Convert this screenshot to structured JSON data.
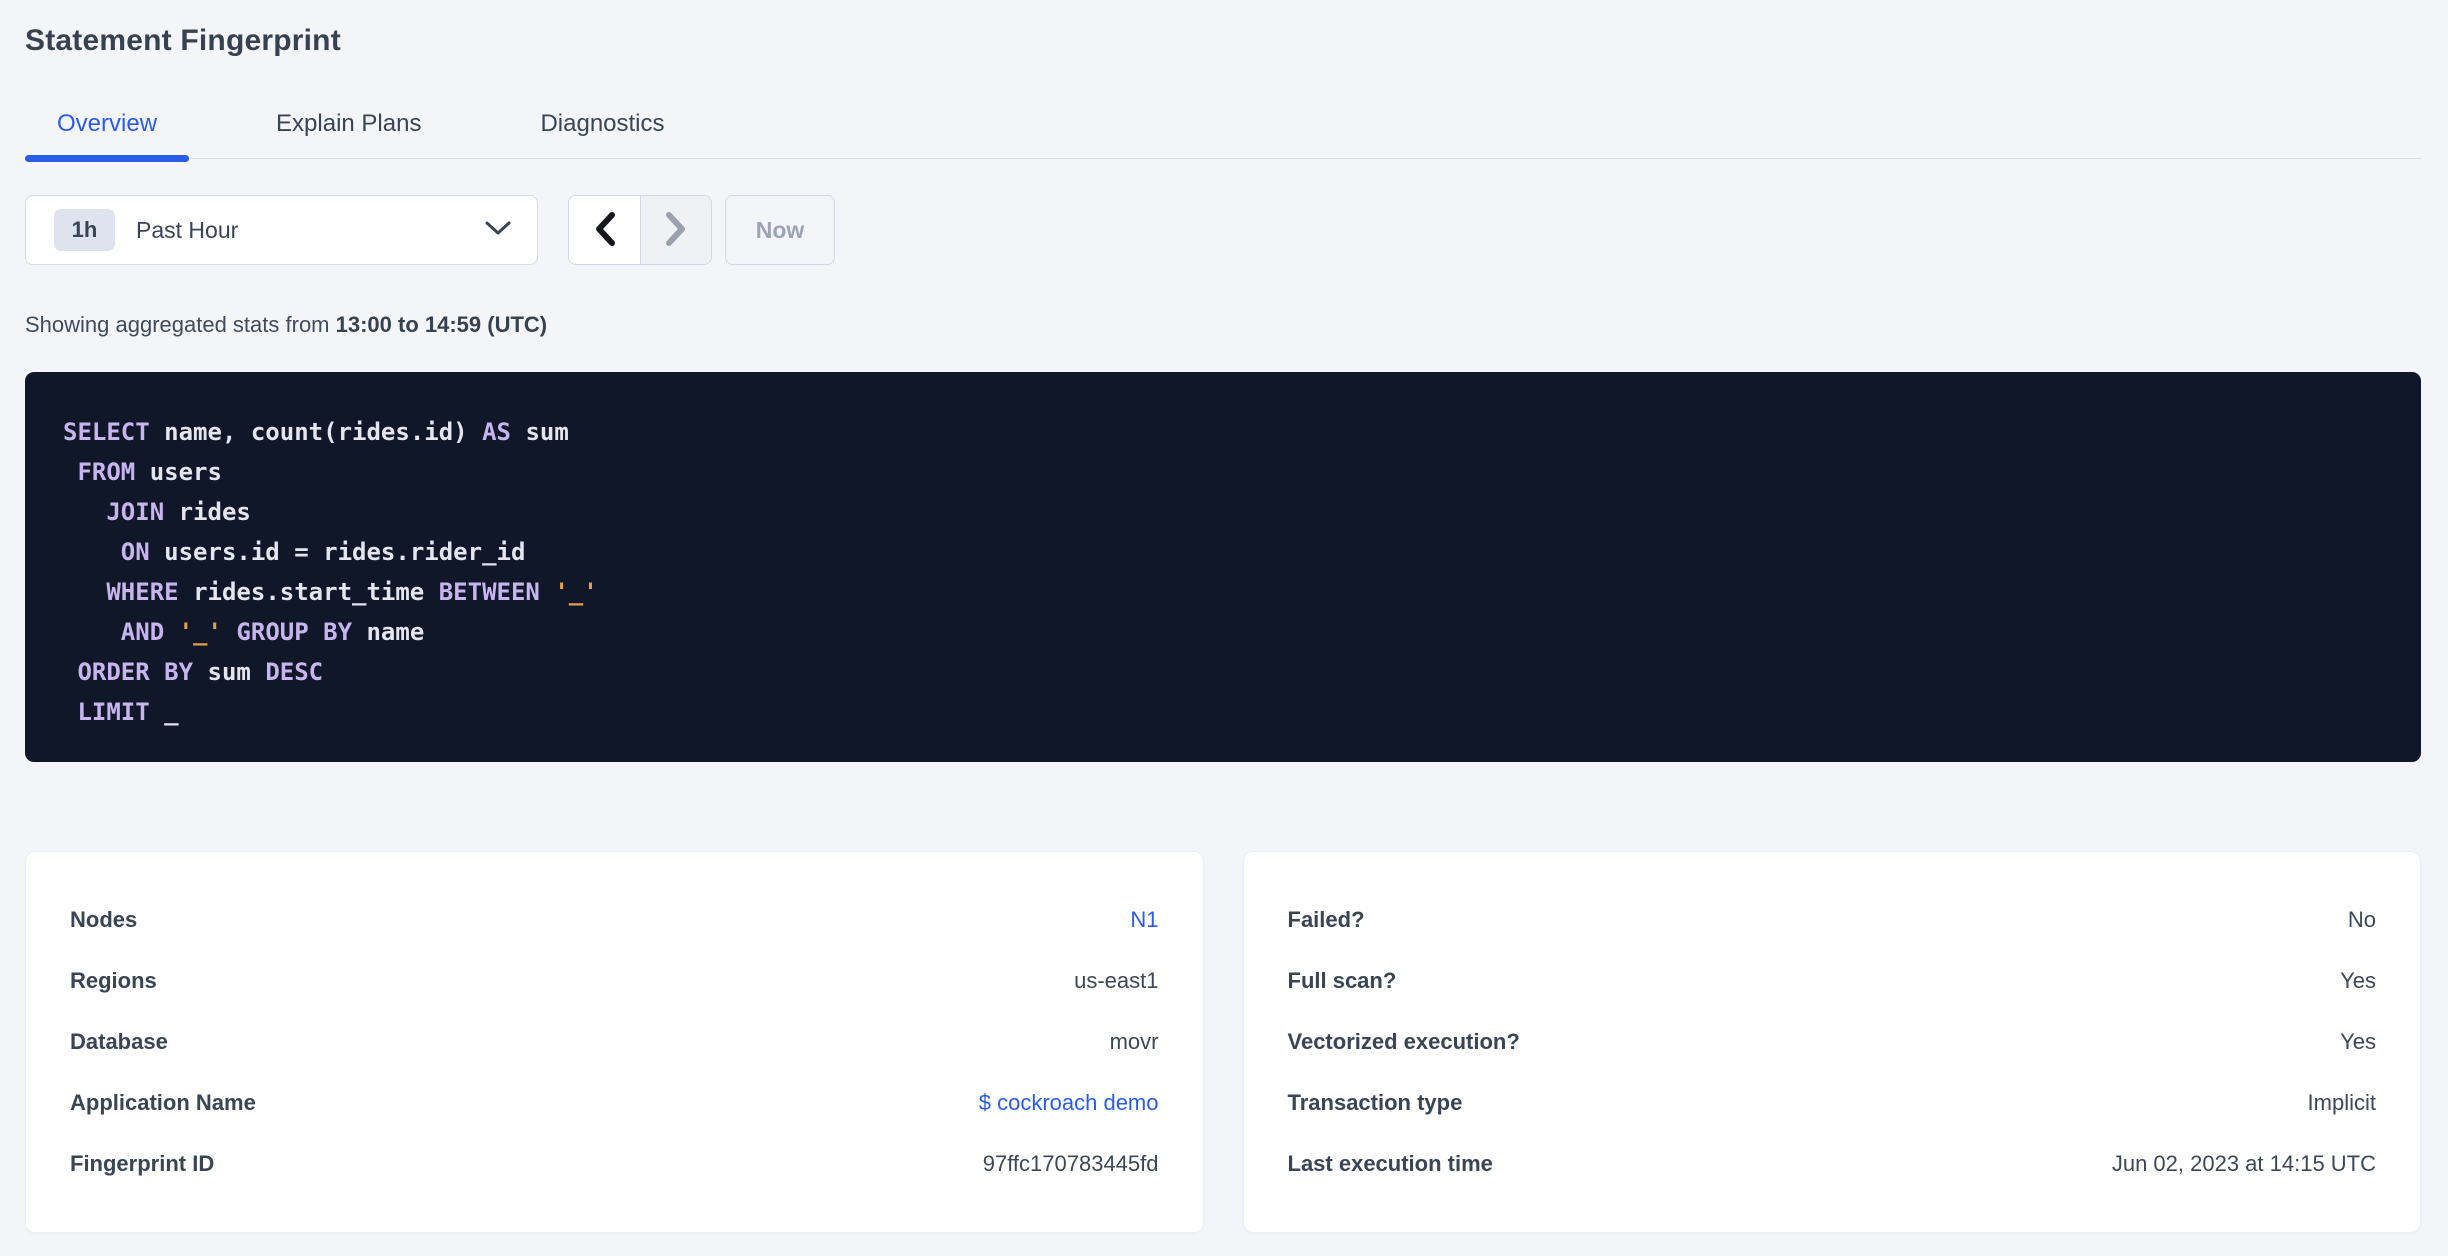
{
  "page": {
    "title": "Statement Fingerprint"
  },
  "tabs": [
    {
      "label": "Overview",
      "active": true
    },
    {
      "label": "Explain Plans",
      "active": false
    },
    {
      "label": "Diagnostics",
      "active": false
    }
  ],
  "time_picker": {
    "badge": "1h",
    "label": "Past Hour",
    "now_label": "Now",
    "prev_enabled": true,
    "next_enabled": false
  },
  "stats_line": {
    "prefix": "Showing aggregated stats from ",
    "range": "13:00 to 14:59 (UTC)"
  },
  "sql": {
    "lines": [
      "SELECT name, count(rides.id) AS sum",
      " FROM users",
      "   JOIN rides",
      "    ON users.id = rides.rider_id",
      "   WHERE rides.start_time BETWEEN '_'",
      "    AND '_' GROUP BY name",
      " ORDER BY sum DESC",
      " LIMIT _"
    ],
    "keywords": [
      "SELECT",
      "FROM",
      "JOIN",
      "ON",
      "AS",
      "WHERE",
      "BETWEEN",
      "AND",
      "GROUP",
      "BY",
      "ORDER",
      "DESC",
      "LIMIT"
    ]
  },
  "cards": {
    "left": {
      "rows": [
        {
          "label": "Nodes",
          "value": "N1",
          "link": true
        },
        {
          "label": "Regions",
          "value": "us-east1",
          "link": false
        },
        {
          "label": "Database",
          "value": "movr",
          "link": false
        },
        {
          "label": "Application Name",
          "value": "$ cockroach demo",
          "link": true
        },
        {
          "label": "Fingerprint ID",
          "value": "97ffc170783445fd",
          "link": false
        }
      ]
    },
    "right": {
      "rows": [
        {
          "label": "Failed?",
          "value": "No",
          "link": false
        },
        {
          "label": "Full scan?",
          "value": "Yes",
          "link": false
        },
        {
          "label": "Vectorized execution?",
          "value": "Yes",
          "link": false
        },
        {
          "label": "Transaction type",
          "value": "Implicit",
          "link": false
        },
        {
          "label": "Last execution time",
          "value": "Jun 02, 2023 at 14:15 UTC",
          "link": false
        }
      ]
    }
  },
  "colors": {
    "accent_blue": "#2a5cea",
    "page_background": "#f4f5f9",
    "sql_background": "#101729",
    "sql_keyword": "#c8b5f0",
    "sql_identifier": "#e3e6ef",
    "sql_literal": "#e5a04c"
  }
}
